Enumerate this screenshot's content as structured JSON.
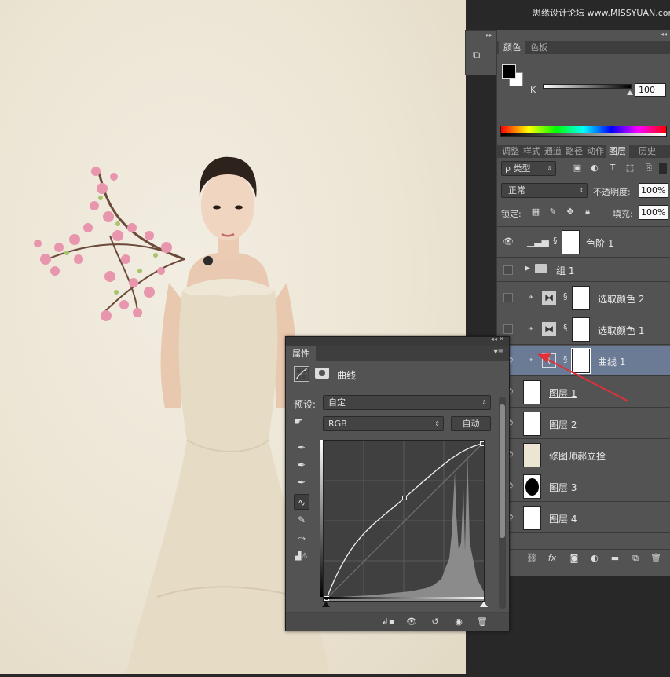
{
  "watermark": "思缘设计论坛 www.MISSYUAN.com",
  "icons": {
    "tool_preset": "tool-preset-icon",
    "eye": "eye-icon",
    "folder": "folder-icon",
    "link": "link-chain-icon",
    "curves": "curves-icon",
    "levels": "levels-icon",
    "selective_color": "selective-color-icon"
  },
  "color_panel": {
    "tabs": [
      "颜色",
      "色板"
    ],
    "active_tab": "颜色",
    "channel_label": "K",
    "k_value": "100",
    "foreground_color": "#000000",
    "background_color": "#ffffff"
  },
  "layers_panel": {
    "tabs": [
      "调整",
      "样式",
      "通道",
      "路径",
      "动作",
      "图层",
      "历史"
    ],
    "active_tab": "图层",
    "filter_label": "ρ 类型",
    "blend_mode": "正常",
    "opacity_label": "不透明度:",
    "opacity_value": "100%",
    "lock_label": "锁定:",
    "fill_label": "填充:",
    "fill_value": "100%",
    "layers": [
      {
        "name": "色阶 1",
        "type": "levels",
        "visible": true,
        "selected": false,
        "clipped": false
      },
      {
        "name": "组 1",
        "type": "group",
        "visible": false,
        "selected": false,
        "clipped": false
      },
      {
        "name": "选取颜色 2",
        "type": "selective_color",
        "visible": false,
        "selected": false,
        "clipped": true
      },
      {
        "name": "选取颜色 1",
        "type": "selective_color",
        "visible": false,
        "selected": false,
        "clipped": true
      },
      {
        "name": "曲线 1",
        "type": "curves",
        "visible": true,
        "selected": true,
        "clipped": true
      },
      {
        "name": "图层 1",
        "type": "pixel",
        "visible": true,
        "selected": false,
        "clipped": false
      },
      {
        "name": "图层 2",
        "type": "pixel",
        "visible": true,
        "selected": false,
        "clipped": false
      },
      {
        "name": "修图师郝立拴",
        "type": "pixel",
        "visible": true,
        "selected": false,
        "clipped": false
      },
      {
        "name": "图层 3",
        "type": "pixel",
        "visible": true,
        "selected": false,
        "clipped": false
      },
      {
        "name": "图层 4",
        "type": "pixel",
        "visible": true,
        "selected": false,
        "clipped": false
      }
    ]
  },
  "properties_panel": {
    "tab": "属性",
    "title": "曲线",
    "preset_label": "预设:",
    "preset_value": "自定",
    "channel_value": "RGB",
    "auto_label": "自动",
    "curve_points": [
      [
        0,
        0
      ],
      [
        0.5,
        0.65
      ],
      [
        1,
        1
      ]
    ]
  },
  "colors": {
    "panel_bg": "#535353",
    "panel_dark": "#3e3e3e",
    "selection": "#6b7b96",
    "annotation_arrow": "#e0303a"
  }
}
